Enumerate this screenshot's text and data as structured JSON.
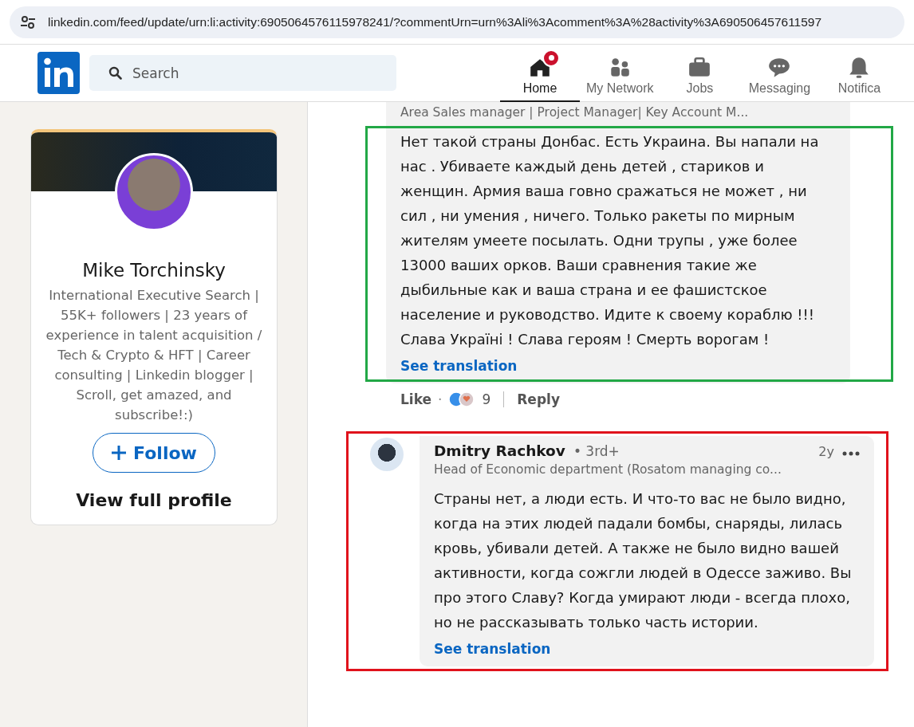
{
  "address_bar": {
    "url": "linkedin.com/feed/update/urn:li:activity:6905064576115978241/?commentUrn=urn%3Ali%3Acomment%3A%28activity%3A690506457611597"
  },
  "header": {
    "search": {
      "placeholder": "Search"
    },
    "nav": [
      {
        "label": "Home",
        "kind": "home",
        "selected": true,
        "badge": true
      },
      {
        "label": "My Network",
        "kind": "network",
        "selected": false,
        "badge": false
      },
      {
        "label": "Jobs",
        "kind": "jobs",
        "selected": false,
        "badge": false
      },
      {
        "label": "Messaging",
        "kind": "messaging",
        "selected": false,
        "badge": false
      },
      {
        "label": "Notifica",
        "kind": "bell",
        "selected": false,
        "badge": false
      }
    ]
  },
  "profile_card": {
    "name": "Mike Torchinsky",
    "headline": "International Executive Search | 55K+ followers | 23 years of experience in talent acquisition / Tech & Crypto & HFT | Career consulting | Linkedin blogger | Scroll, get amazed, and subscribe!:)",
    "follow_button": "Follow",
    "view_profile": "View full profile"
  },
  "comments": [
    {
      "headline": "Area Sales manager | Project Manager| Key Account M...",
      "text": "Нет такой страны Донбас. Есть Украина. Вы напали на нас . Убиваете каждый день детей , стариков и женщин. Армия ваша говно сражаться не может , ни сил , ни умения , ничего. Только ракеты по мирным жителям умеете посылать. Одни трупы , уже более 13000 ваших орков. Ваши сравнения такие же дыбильные как и ваша страна и ее фашистское население и руководство. Идите к своему кораблю !!! Слава Україні ! Слава героям ! Смерть ворогам !",
      "see_translation": "See translation",
      "highlight": {
        "color": "#22a846",
        "kind": "body"
      },
      "like": "Like",
      "separator": "·",
      "reactions": "9",
      "reply": "Reply"
    },
    {
      "author": "Dmitry Rachkov",
      "degree": "• 3rd+",
      "age": "2y",
      "headline": "Head of Economic department (Rosatom managing co...",
      "text": "Страны нет, а люди есть. И что-то вас не было видно, когда на этих людей падали бомбы, снаряды, лилась кровь, убивали детей. А также не было видно вашей активности, когда сожгли людей в Одессе заживо. Вы про этого Славу? Когда умирают люди - всегда плохо, но не рассказывать только часть истории.",
      "see_translation": "See translation",
      "highlight": {
        "color": "#e0121c",
        "kind": "whole"
      }
    }
  ]
}
